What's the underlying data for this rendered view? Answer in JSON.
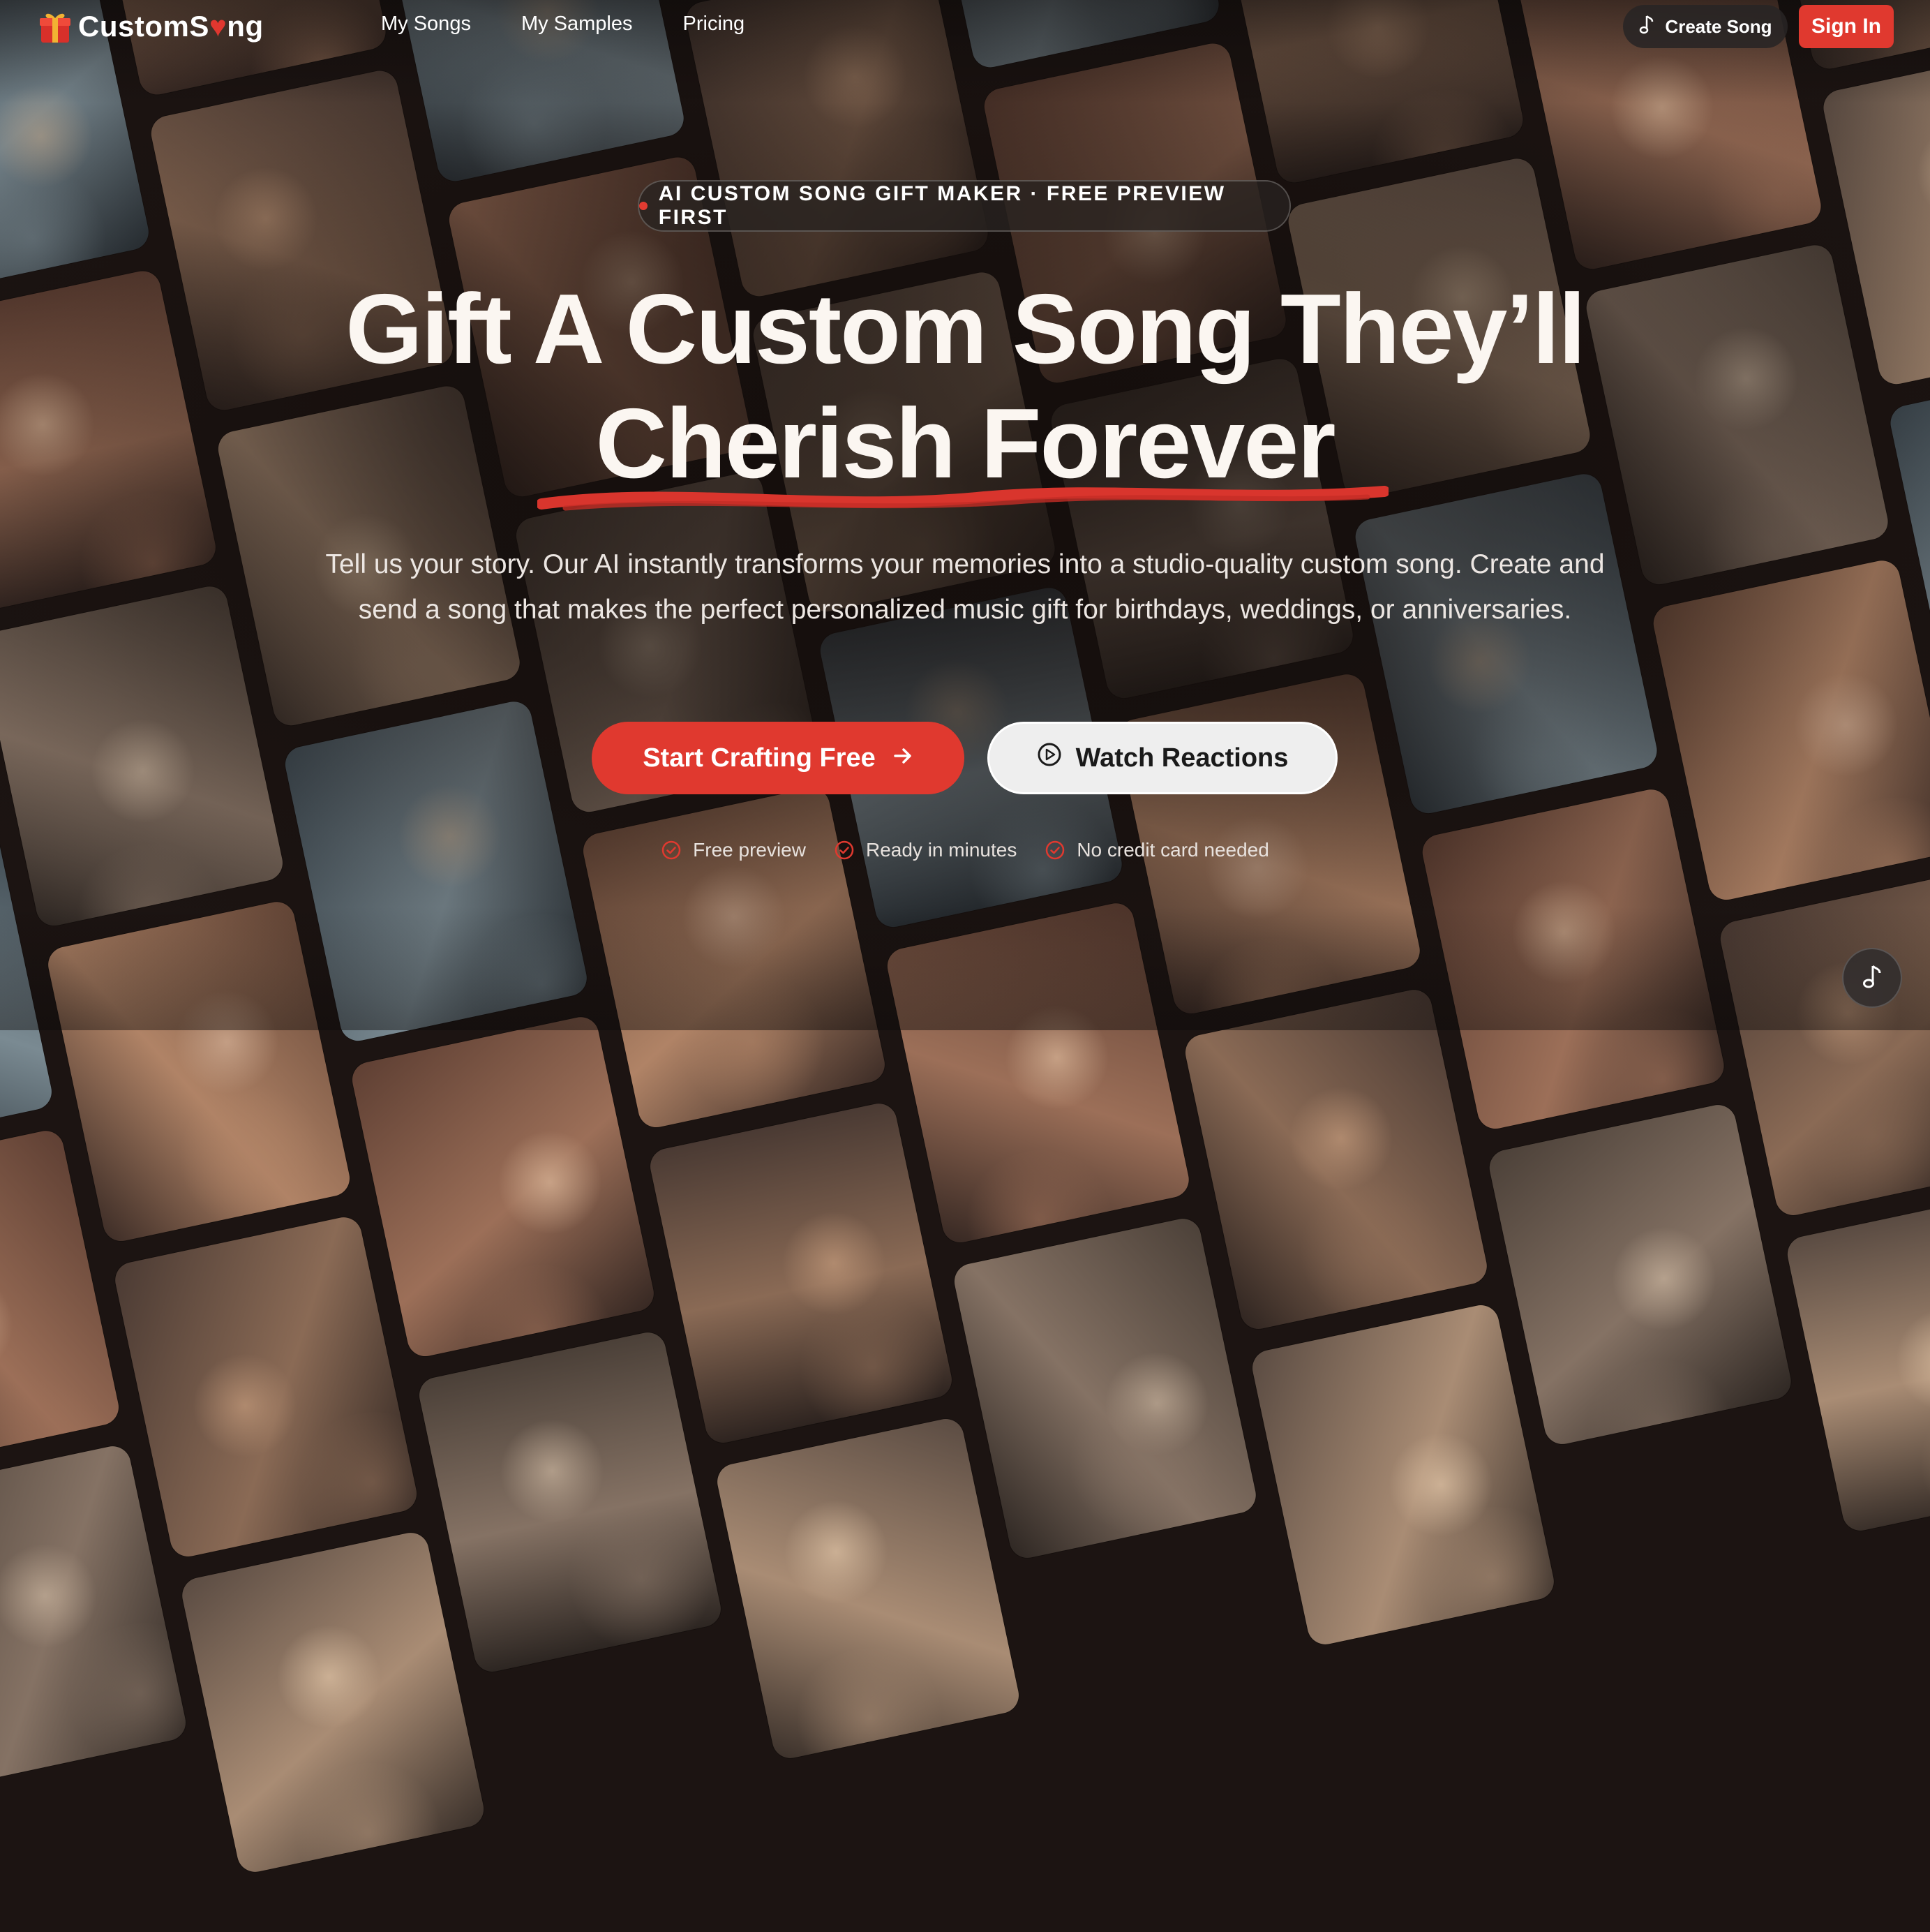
{
  "header": {
    "logo_text_pre": "CustomS",
    "logo_text_post": "ng",
    "nav": [
      "My Songs",
      "My Samples",
      "Pricing"
    ],
    "create_song": "Create Song",
    "sign_in": "Sign In"
  },
  "hero": {
    "badge": "AI CUSTOM SONG GIFT MAKER · FREE PREVIEW FIRST",
    "headline_line1": "Gift A Custom Song They’ll",
    "headline_line2": "Cherish Forever",
    "subtitle": "Tell us your story. Our AI instantly transforms your memories into a studio-quality custom song. Create and send a song that makes the perfect personalized music gift for birthdays, weddings, or anniversaries.",
    "primary_cta": "Start Crafting Free",
    "secondary_cta": "Watch Reactions",
    "checks": [
      "Free preview",
      "Ready in minutes",
      "No credit card needed"
    ]
  },
  "colors": {
    "accent": "#e0392f",
    "background": "#1c1412",
    "heading": "#fbf6f1"
  },
  "icons": {
    "logo": "gift-icon",
    "logo_heart": "heart-icon",
    "create_song": "music-note-icon",
    "primary_cta": "arrow-right-icon",
    "secondary_cta": "play-circle-icon",
    "checks": "check-circle-icon",
    "floating": "music-note-icon"
  }
}
